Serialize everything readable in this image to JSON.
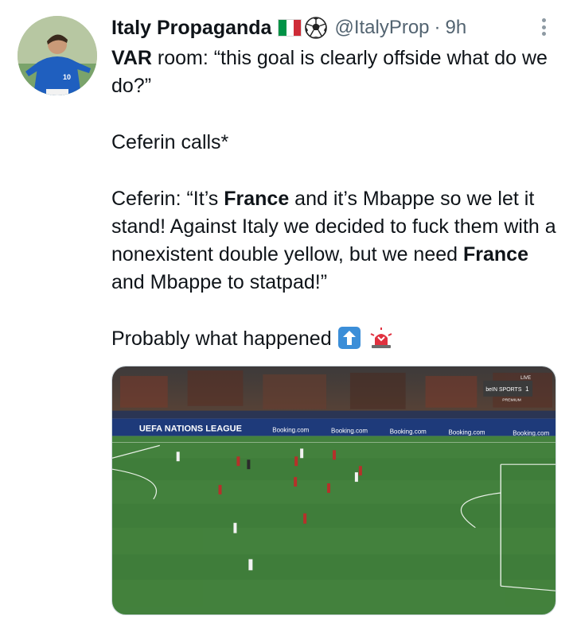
{
  "tweet": {
    "display_name": "Italy Propaganda",
    "handle": "@ItalyProp",
    "separator": "·",
    "time": "9h",
    "flag_icon": "italy-flag-icon",
    "ball_icon": "soccer-ball-icon",
    "body": {
      "p1_bold": "VAR",
      "p1_rest": " room: “this goal is clearly offside what do we do?”",
      "p2": "Ceferin calls*",
      "p3_a": "Ceferin: “It’s ",
      "p3_b_bold": "France",
      "p3_c": " and it’s Mbappe so we let it stand! Against Italy we decided to fuck them with a nonexistent double yellow, but we need ",
      "p3_d_bold": "France",
      "p3_e": " and Mbappe to statpad!”",
      "p4": "Probably what happened"
    },
    "emoji": [
      "up-arrow-emoji",
      "siren-emoji"
    ],
    "media": {
      "description_icon": "football-pitch-image",
      "ad_board_text": "UEFA NATIONS LEAGUE",
      "sponsor_text": "Booking.com",
      "broadcaster": "beIN SPORTS",
      "live_label": "LIVE",
      "premium_label": "PREMIUM",
      "channel_number": "1"
    }
  },
  "colors": {
    "text": "#0f1419",
    "secondary": "#536471",
    "flag_green": "#009246",
    "flag_white": "#ffffff",
    "flag_red": "#ce2b37",
    "pitch": "#3f7d3a"
  }
}
